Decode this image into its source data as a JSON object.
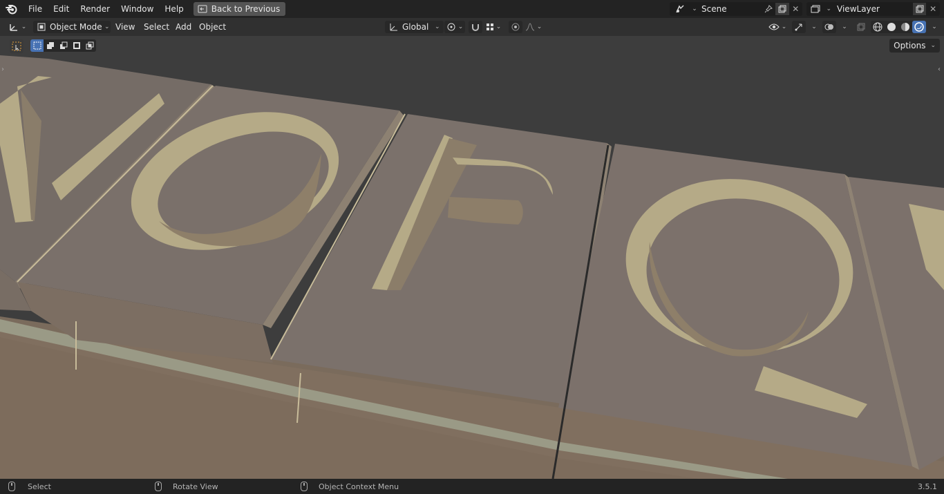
{
  "topbar": {
    "menus": [
      "File",
      "Edit",
      "Render",
      "Window",
      "Help"
    ],
    "back_button": "Back to Previous",
    "scene_label": "Scene",
    "viewlayer_label": "ViewLayer"
  },
  "header": {
    "mode": "Object Mode",
    "menus": [
      "View",
      "Select",
      "Add",
      "Object"
    ],
    "transform_orientation": "Global",
    "options": "Options"
  },
  "viewport": {
    "letters": [
      "N",
      "O",
      "P",
      "Q"
    ]
  },
  "statusbar": {
    "select": "Select",
    "rotate": "Rotate View",
    "context_menu": "Object Context Menu",
    "version": "3.5.1"
  },
  "colors": {
    "tile_top": "#7a7068",
    "tile_side": "#80705f",
    "engraving": "#b5aa87",
    "accent_blue": "#4772b3"
  }
}
